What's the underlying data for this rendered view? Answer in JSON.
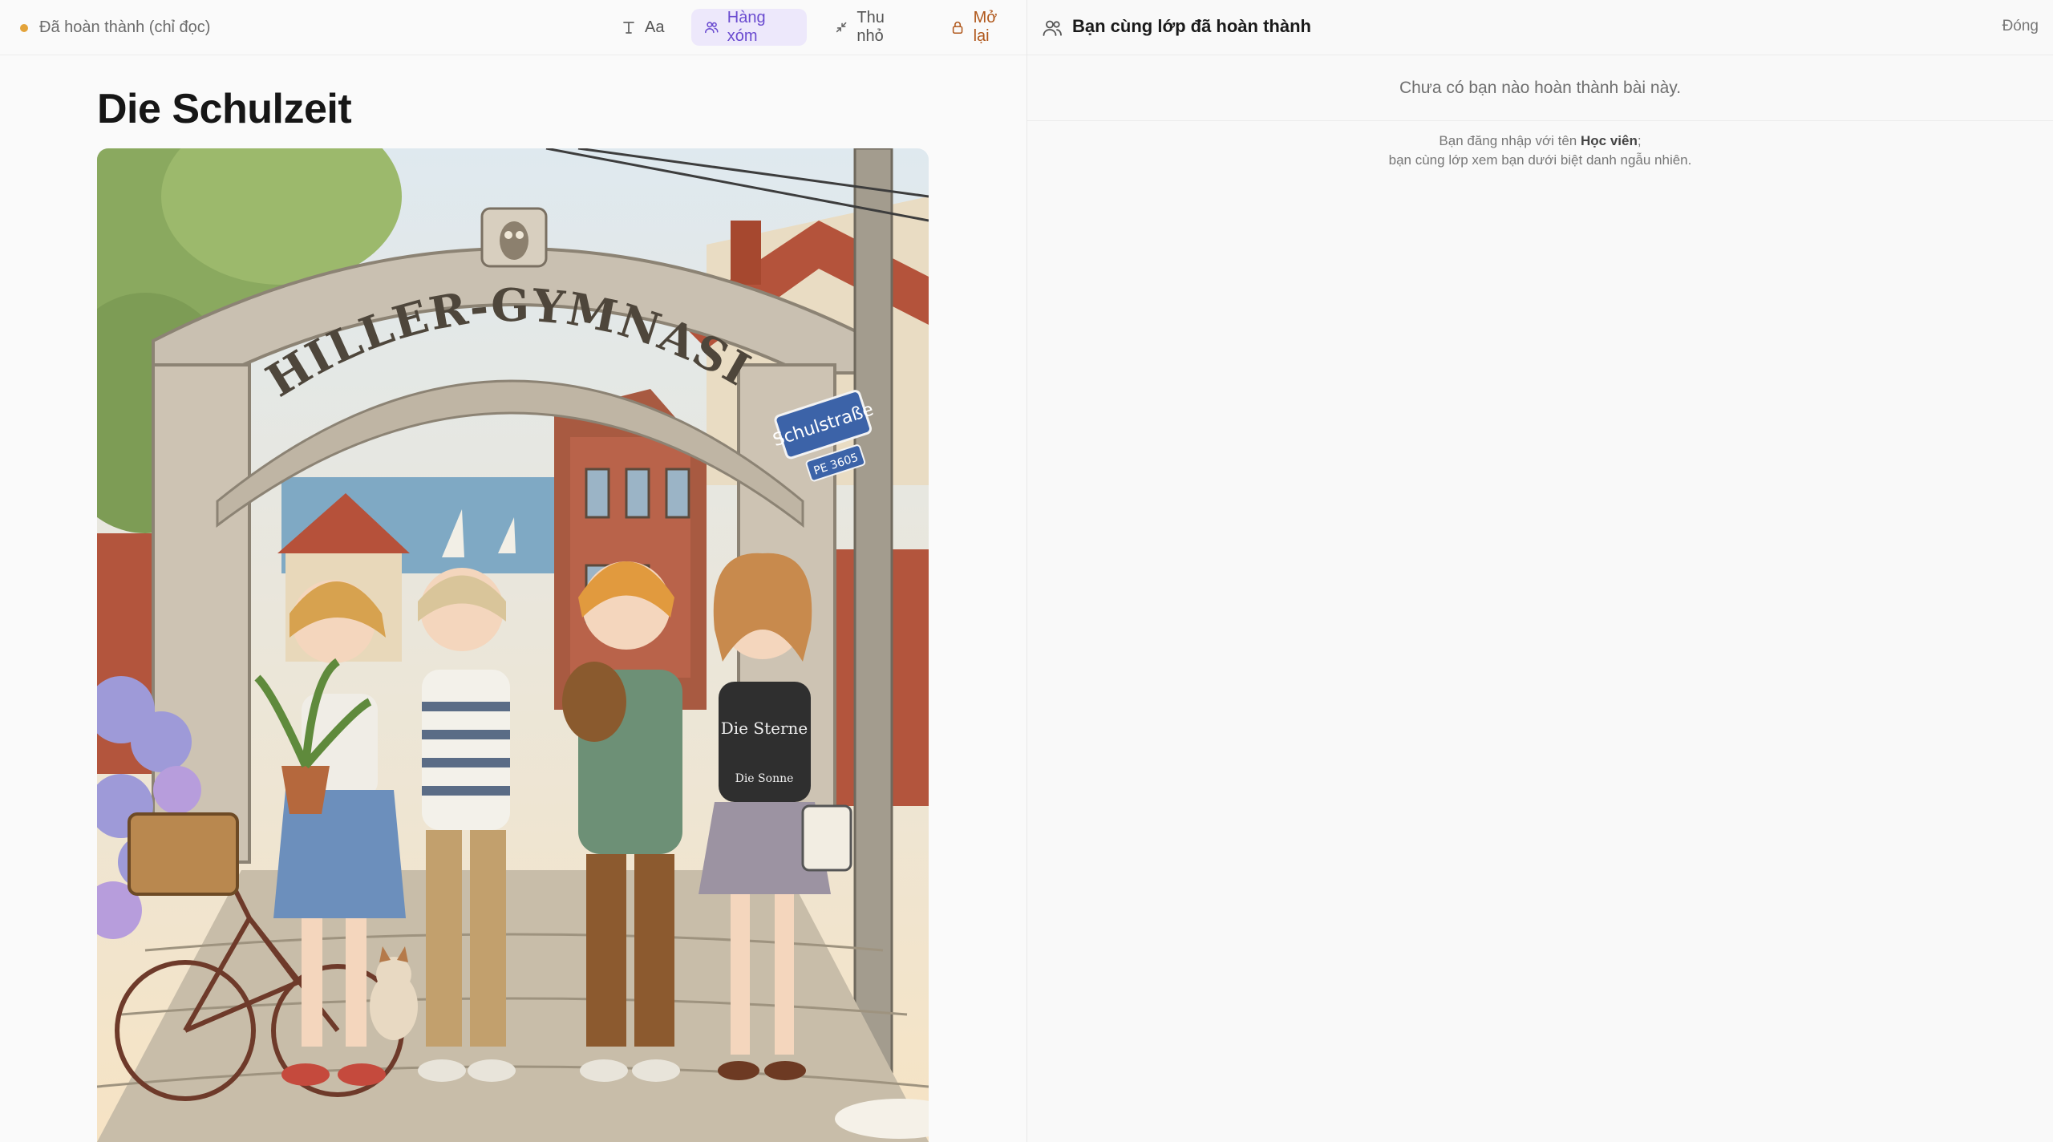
{
  "toolbar": {
    "status_text": "Đã hoàn thành (chỉ đọc)",
    "status_color": "#e3a33a",
    "tools": [
      {
        "label": "Aa",
        "icon": "text-size-icon"
      },
      {
        "label": "Hàng xóm",
        "icon": "people-icon",
        "active": true
      },
      {
        "label": "Thu nhỏ",
        "icon": "minimize-icon"
      },
      {
        "label": "Mở lại",
        "icon": "lock-icon"
      }
    ]
  },
  "document": {
    "title": "Die Schulzeit",
    "illustration": {
      "arch_text": "SCHILLER-GYMNASIUM",
      "street_sign": "Schulstraße",
      "street_sign_sub": "PE 3605",
      "shirt_text_1": "Die Sterne",
      "shirt_text_2": "Die Sonne"
    }
  },
  "sidebar": {
    "title": "Bạn cùng lớp đã hoàn thành",
    "close_label": "Đóng",
    "empty_message": "Chưa có bạn nào hoàn thành bài này.",
    "login_note_prefix": "Bạn đăng nhập với tên ",
    "login_name": "Học viên",
    "login_note_suffix": ";",
    "login_note_line2": "bạn cùng lớp xem bạn dưới biệt danh ngẫu nhiên."
  },
  "colors": {
    "accent": "#6a4bd0",
    "accent_bg": "#ede8fb",
    "warn": "#b0581c"
  }
}
